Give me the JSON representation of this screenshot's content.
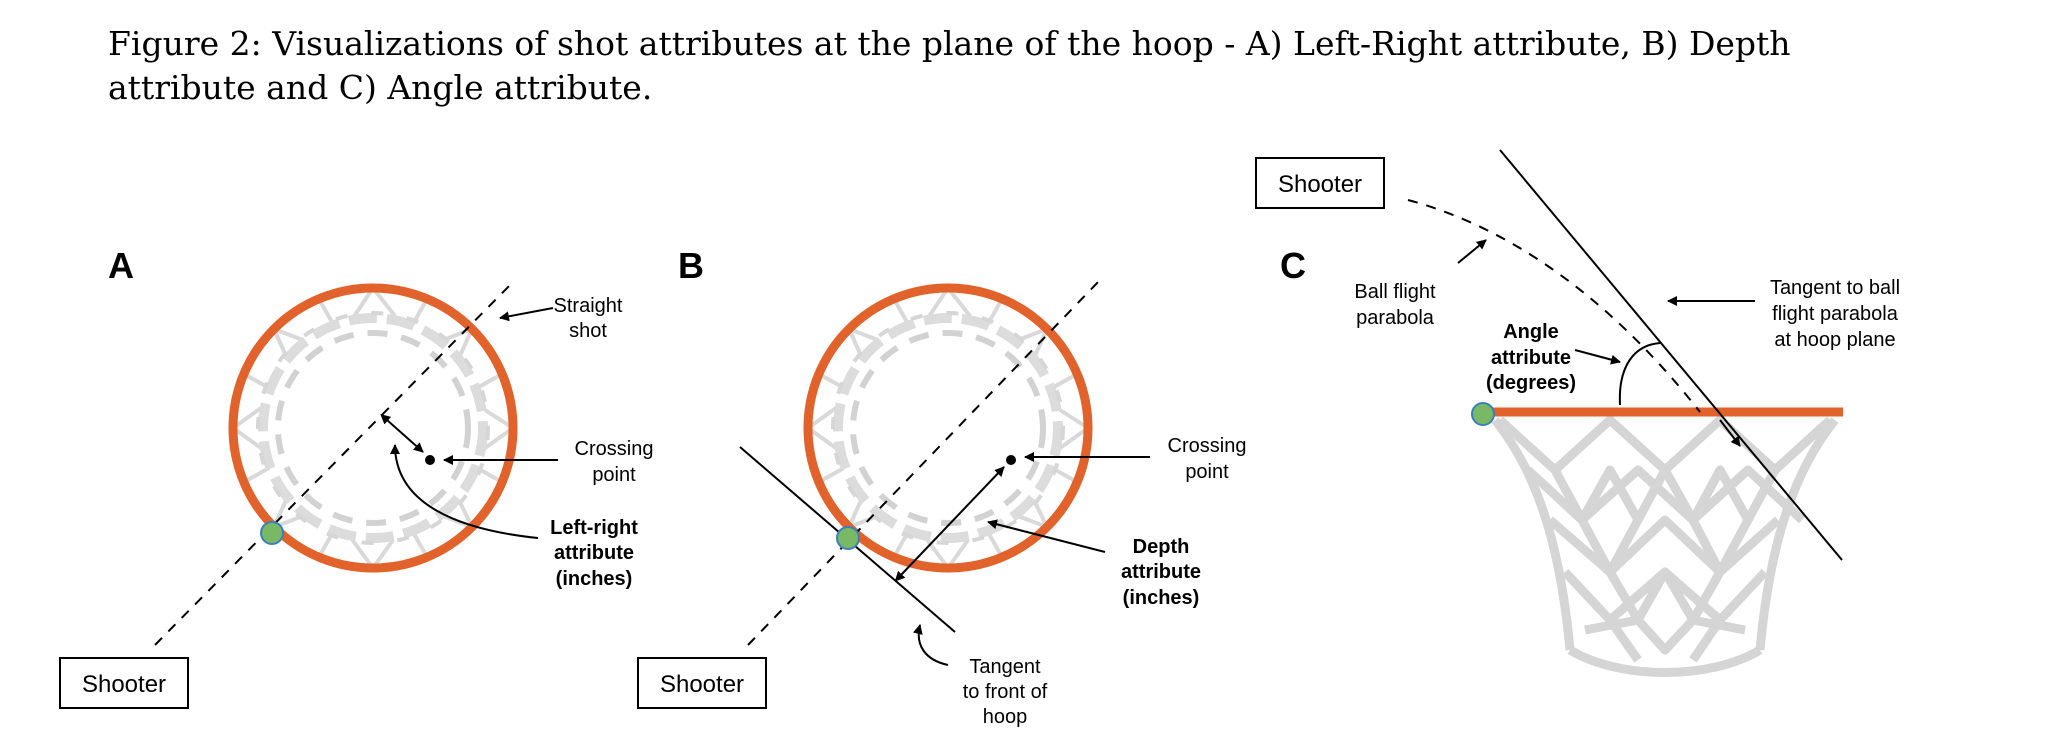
{
  "caption": {
    "line1": "Figure 2: Visualizations of shot attributes at the plane of the hoop - A) Left-Right attribute, B) Depth",
    "line2": "attribute and C) Angle attribute."
  },
  "colors": {
    "rim": "#e2622b",
    "net": "#d9d9d9",
    "ball": "#79b864",
    "ball_stroke": "#3a7fbf"
  },
  "panel_a": {
    "letter": "A",
    "shooter": "Shooter",
    "straight_shot": [
      "Straight",
      "shot"
    ],
    "crossing_point": [
      "Crossing",
      "point"
    ],
    "attribute": [
      "Left-right",
      "attribute",
      "(inches)"
    ]
  },
  "panel_b": {
    "letter": "B",
    "shooter": "Shooter",
    "crossing_point": [
      "Crossing",
      "point"
    ],
    "attribute": [
      "Depth",
      "attribute",
      "(inches)"
    ],
    "tangent": [
      "Tangent",
      "to front of",
      "hoop"
    ]
  },
  "panel_c": {
    "letter": "C",
    "shooter": "Shooter",
    "parabola": [
      "Ball flight",
      "parabola"
    ],
    "attribute": [
      "Angle",
      "attribute",
      "(degrees)"
    ],
    "tangent": [
      "Tangent to ball",
      "flight parabola",
      "at hoop plane"
    ]
  }
}
